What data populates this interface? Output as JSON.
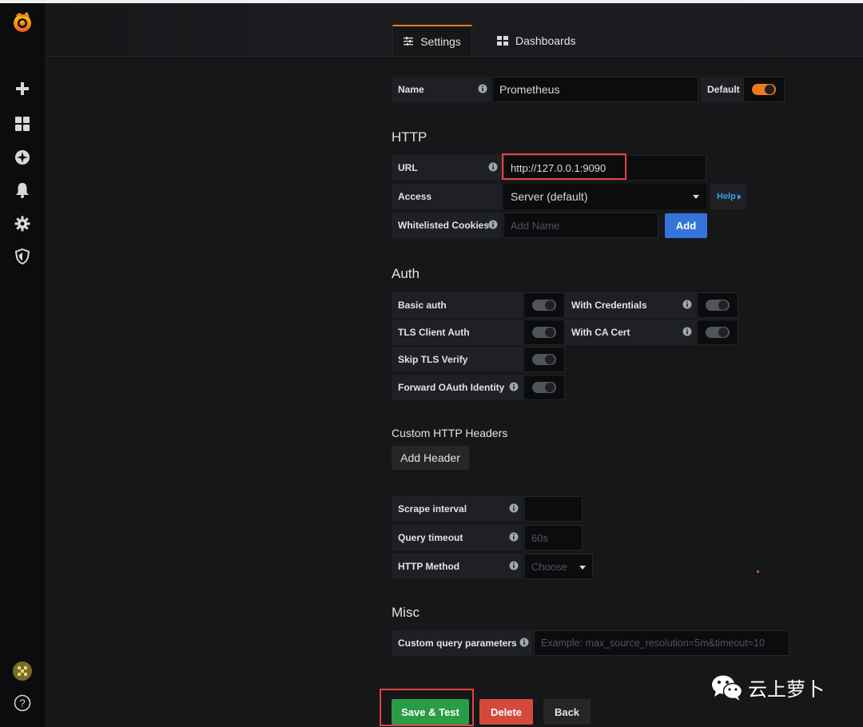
{
  "tabs": {
    "settings": "Settings",
    "dashboards": "Dashboards"
  },
  "name_row": {
    "label": "Name",
    "value": "Prometheus",
    "default_label": "Default",
    "default_on": true
  },
  "http": {
    "title": "HTTP",
    "url_label": "URL",
    "url_value": "http://127.0.0.1:9090",
    "access_label": "Access",
    "access_value": "Server (default)",
    "help_label": "Help",
    "cookies_label": "Whitelisted Cookies",
    "cookies_placeholder": "Add Name",
    "add_label": "Add"
  },
  "auth": {
    "title": "Auth",
    "basic_auth": "Basic auth",
    "with_credentials": "With Credentials",
    "tls_client_auth": "TLS Client Auth",
    "with_ca_cert": "With CA Cert",
    "skip_tls_verify": "Skip TLS Verify",
    "forward_oauth": "Forward OAuth Identity"
  },
  "custom_headers": {
    "title": "Custom HTTP Headers",
    "add_header": "Add Header"
  },
  "prom": {
    "scrape_label": "Scrape interval",
    "scrape_value": "",
    "timeout_label": "Query timeout",
    "timeout_placeholder": "60s",
    "method_label": "HTTP Method",
    "method_placeholder": "Choose"
  },
  "misc": {
    "title": "Misc",
    "custom_params_label": "Custom query parameters",
    "custom_params_placeholder": "Example: max_source_resolution=5m&timeout=10"
  },
  "actions": {
    "save": "Save & Test",
    "delete": "Delete",
    "back": "Back"
  },
  "watermark": "云上萝卜",
  "colors": {
    "accent": "#eb7b18",
    "save": "#299c46",
    "delete": "#d44a3a",
    "primary": "#3274d9",
    "highlight": "#e0443e"
  }
}
